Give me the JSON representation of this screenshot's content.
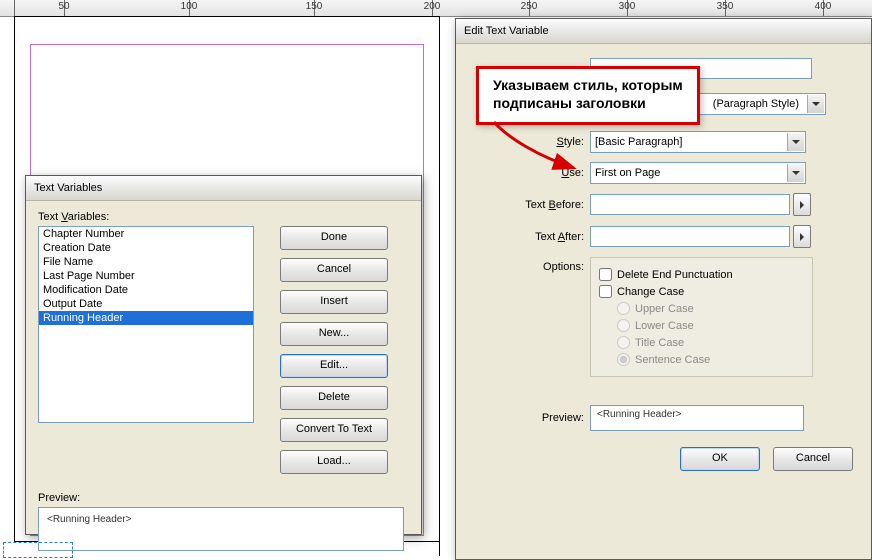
{
  "ruler": {
    "ticks": [
      50,
      100,
      150,
      200,
      250,
      300,
      350,
      400
    ]
  },
  "callout": {
    "line1": "Указываем стиль, которым",
    "line2": "подписаны заголовки"
  },
  "dialog1": {
    "title": "Text Variables",
    "list_label_pre": "Text ",
    "list_label_u": "V",
    "list_label_post": "ariables:",
    "items": [
      "Chapter Number",
      "Creation Date",
      "File Name",
      "Last Page Number",
      "Modification Date",
      "Output Date",
      "Running Header"
    ],
    "selected_index": 6,
    "buttons": {
      "done": "Done",
      "cancel": "Cancel",
      "insert": "Insert",
      "new": "New...",
      "edit": "Edit...",
      "delete": "Delete",
      "convert": "Convert To Text",
      "load": "Load..."
    },
    "preview_label": "Preview:",
    "preview_value": "<Running Header>"
  },
  "dialog2": {
    "title": "Edit Text Variable",
    "top_input_value": "",
    "type_suffix_label": "(Paragraph Style)",
    "rows": {
      "style": {
        "label_pre": "",
        "label_u": "S",
        "label_post": "tyle:",
        "value": "[Basic Paragraph]"
      },
      "use": {
        "label_pre": "",
        "label_u": "U",
        "label_post": "se:",
        "value": "First on Page"
      },
      "before": {
        "label_pre": "Text ",
        "label_u": "B",
        "label_post": "efore:",
        "value": ""
      },
      "after": {
        "label_pre": "Text ",
        "label_u": "A",
        "label_post": "fter:",
        "value": ""
      }
    },
    "options_label": "Options:",
    "options": {
      "delete_end": {
        "label": "Delete End Punctuation",
        "checked": false
      },
      "change_case": {
        "label": "Change Case",
        "checked": false
      },
      "upper": "Upper Case",
      "lower": "Lower Case",
      "title": "Title Case",
      "sentence": "Sentence Case",
      "selected_case": "sentence"
    },
    "preview_label": "Preview:",
    "preview_value": "<Running Header>",
    "ok": "OK",
    "cancel": "Cancel"
  }
}
